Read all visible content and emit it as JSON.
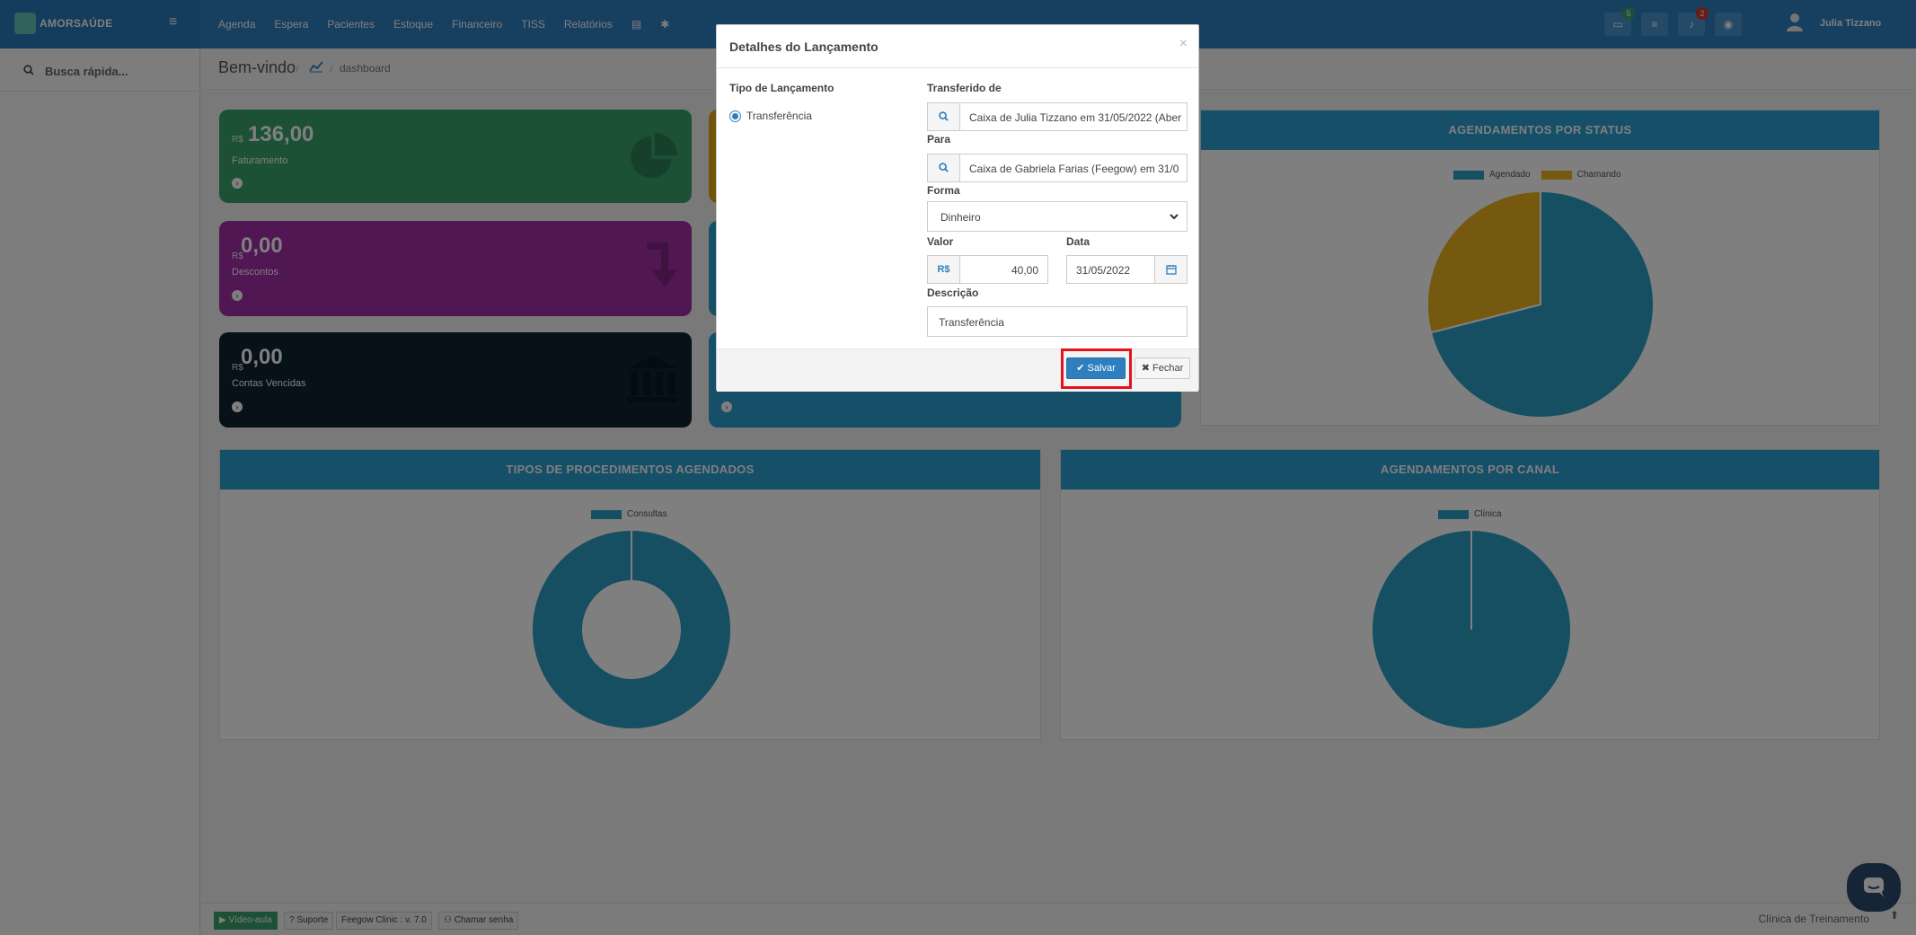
{
  "app": {
    "brand": "AMORSAÚDE",
    "menu": [
      "Agenda",
      "Espera",
      "Pacientes",
      "Estoque",
      "Financeiro",
      "TISS",
      "Relatórios"
    ],
    "notifications": {
      "badge_green": "5",
      "badge_red": "2"
    },
    "user_name": "Julia Tizzano"
  },
  "sidebar": {
    "search_placeholder": "Busca rápida..."
  },
  "breadcrumb": {
    "title": "Bem-vindo",
    "current": "dashboard"
  },
  "cards": {
    "faturamento": {
      "currency": "R$",
      "amount": "136,00",
      "label": "Faturamento"
    },
    "descontos": {
      "currency": "R$",
      "amount": "0,00",
      "label": "Descontos"
    },
    "contas_vencidas": {
      "currency": "R$",
      "amount": "0,00",
      "label": "Contas Vencidas"
    }
  },
  "panels": {
    "status": {
      "title": "AGENDAMENTOS POR STATUS",
      "legend": [
        "Agendado",
        "Chamando"
      ]
    },
    "procedimentos": {
      "title": "TIPOS DE PROCEDIMENTOS AGENDADOS",
      "legend": [
        "Consultas"
      ]
    },
    "canal": {
      "title": "AGENDAMENTOS POR CANAL",
      "legend": [
        "Clínica"
      ]
    }
  },
  "chart_data": [
    {
      "type": "pie",
      "title": "AGENDAMENTOS POR STATUS",
      "categories": [
        "Agendado",
        "Chamando"
      ],
      "values": [
        71,
        29
      ],
      "colors": [
        "#2a9fc2",
        "#e8b31f"
      ]
    },
    {
      "type": "pie",
      "title": "TIPOS DE PROCEDIMENTOS AGENDADOS",
      "categories": [
        "Consultas"
      ],
      "values": [
        100
      ],
      "colors": [
        "#2a9fc2"
      ],
      "donut": true
    },
    {
      "type": "pie",
      "title": "AGENDAMENTOS POR CANAL",
      "categories": [
        "Clínica"
      ],
      "values": [
        100
      ],
      "colors": [
        "#2a9fc2"
      ]
    }
  ],
  "footer": {
    "video": "Vídeo-aula",
    "support": "Suporte",
    "version": "Feegow Clinic : v. 7.0",
    "call_password": "Chamar senha",
    "clinic": "Clínica de Treinamento"
  },
  "modal": {
    "title": "Detalhes do Lançamento",
    "close": "×",
    "tipo_label": "Tipo de Lançamento",
    "tipo_value": "Transferência",
    "transferido_de_label": "Transferido de",
    "transferido_de_value": "Caixa de Julia Tizzano em 31/05/2022 (Aber",
    "para_label": "Para",
    "para_value": "Caixa de Gabriela Farias (Feegow) em 31/0",
    "forma_label": "Forma",
    "forma_value": "Dinheiro",
    "valor_label": "Valor",
    "valor_currency": "R$",
    "valor_value": "40,00",
    "data_label": "Data",
    "data_value": "31/05/2022",
    "descricao_label": "Descrição",
    "descricao_value": "Transferência",
    "save_label": "Salvar",
    "close_label": "Fechar"
  },
  "colors": {
    "navbar": "#2e7fc0",
    "accent": "#2d9fd0",
    "highlight": "#e3121c",
    "green_card": "#3aa36c",
    "purple_card": "#a02ea6",
    "dark_card": "#0d2230"
  }
}
